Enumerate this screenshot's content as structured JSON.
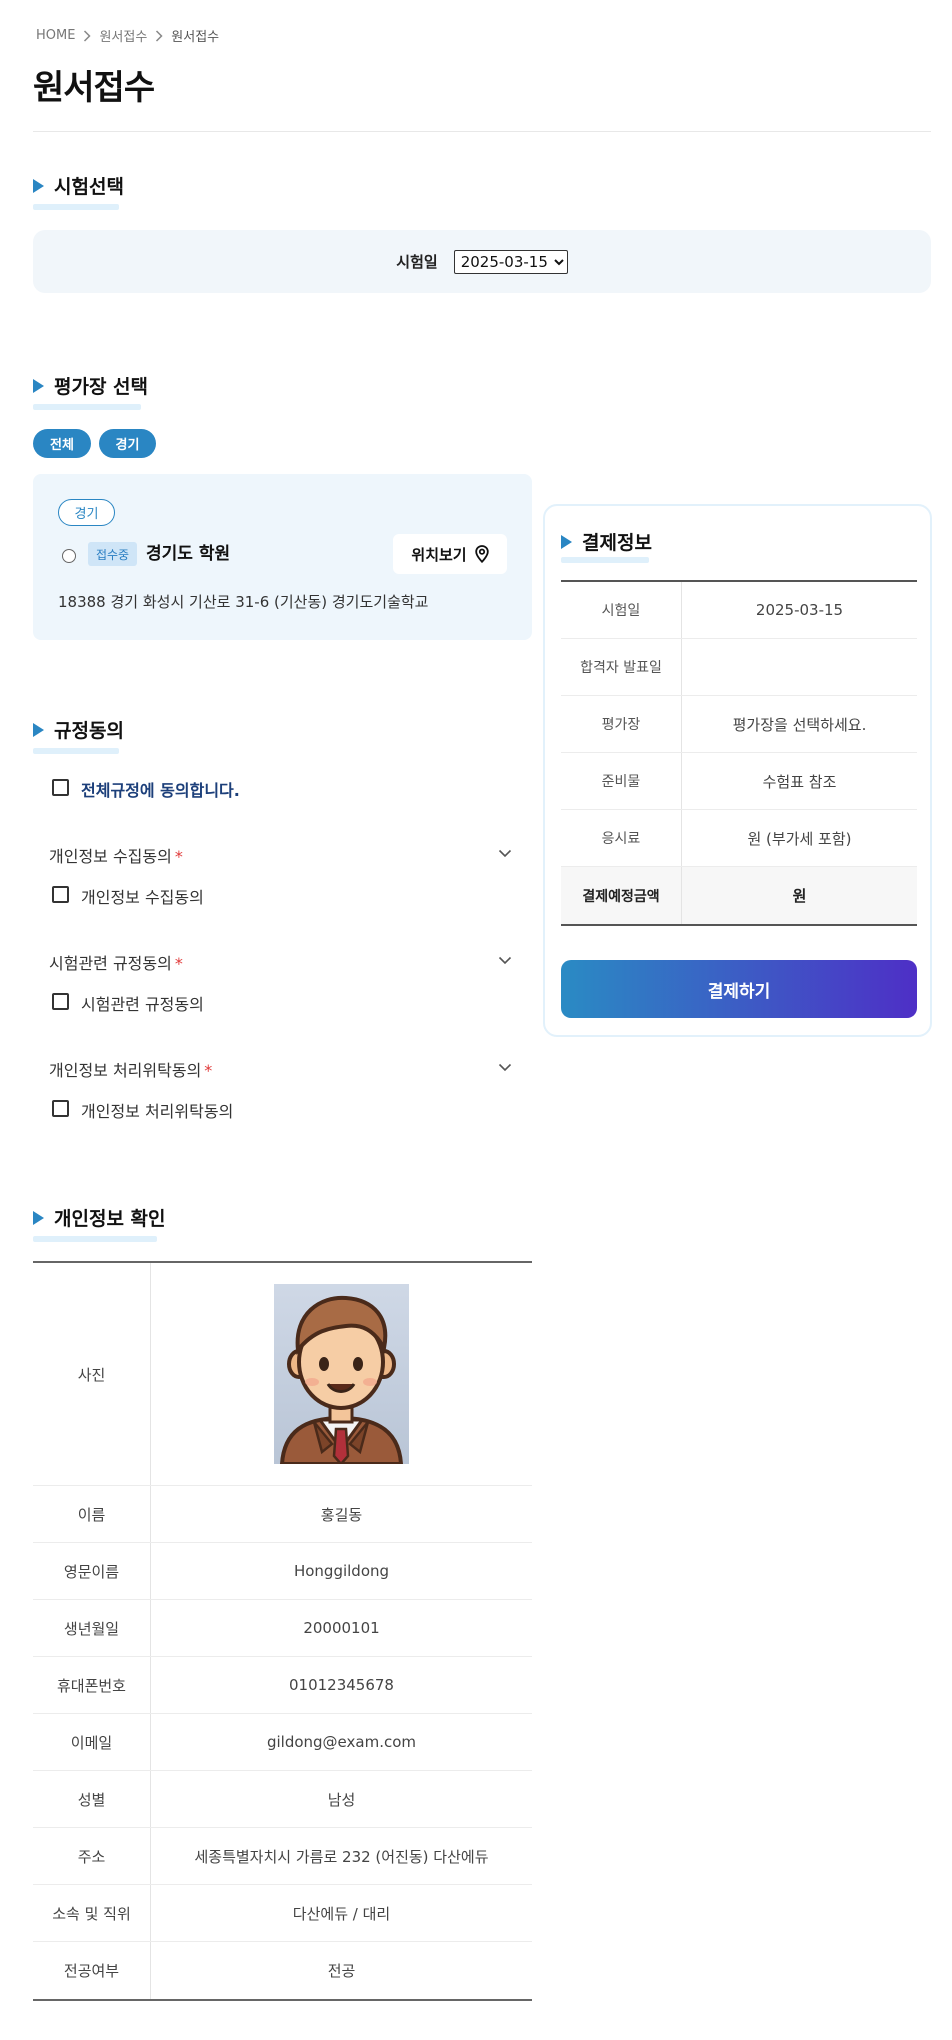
{
  "breadcrumb": {
    "home": "HOME",
    "level1": "원서접수",
    "level2": "원서접수"
  },
  "page_title": "원서접수",
  "exam_section": {
    "title": "시험선택",
    "date_label": "시험일",
    "date_value": "2025-03-15"
  },
  "venue_section": {
    "title": "평가장 선택",
    "filters": [
      "전체",
      "경기"
    ],
    "venue": {
      "region_tag": "경기",
      "status_badge": "접수중",
      "name": "경기도 학원",
      "location_button": "위치보기",
      "address": "18388 경기 화성시 기산로 31-6 (기산동) 경기도기술학교"
    }
  },
  "payment": {
    "title": "결제정보",
    "rows": [
      {
        "label": "시험일",
        "value": "2025-03-15"
      },
      {
        "label": "합격자 발표일",
        "value": ""
      },
      {
        "label": "평가장",
        "value": "평가장을 선택하세요."
      },
      {
        "label": "준비물",
        "value": "수험표 참조"
      },
      {
        "label": "응시료",
        "value": "원 (부가세 포함)"
      },
      {
        "label": "결제예정금액",
        "value": "원"
      }
    ],
    "button": "결제하기"
  },
  "agreement": {
    "title": "규정동의",
    "all_label": "전체규정에 동의합니다.",
    "items": [
      {
        "heading": "개인정보 수집동의",
        "required": "*",
        "checkbox_label": "개인정보 수집동의"
      },
      {
        "heading": "시험관련 규정동의",
        "required": "*",
        "checkbox_label": "시험관련 규정동의"
      },
      {
        "heading": "개인정보 처리위탁동의",
        "required": "*",
        "checkbox_label": "개인정보 처리위탁동의"
      }
    ]
  },
  "personal_info": {
    "title": "개인정보 확인",
    "photo_label": "사진",
    "rows": [
      {
        "label": "이름",
        "value": "홍길동"
      },
      {
        "label": "영문이름",
        "value": "Honggildong"
      },
      {
        "label": "생년월일",
        "value": "20000101"
      },
      {
        "label": "휴대폰번호",
        "value": "01012345678"
      },
      {
        "label": "이메일",
        "value": "gildong@exam.com"
      },
      {
        "label": "성별",
        "value": "남성"
      },
      {
        "label": "주소",
        "value": "세종특별자치시 가름로 232 (어진동) 다산에듀"
      },
      {
        "label": "소속 및 직위",
        "value": "다산에듀 / 대리"
      },
      {
        "label": "전공여부",
        "value": "전공"
      }
    ]
  },
  "colors": {
    "accent": "#2a86c3",
    "required": "#e03a3a",
    "button_gradient_start": "#2a8bc4",
    "button_gradient_end": "#4e2fc6"
  },
  "icons": {
    "breadcrumb_separator": "chevron-right-icon",
    "location": "map-pin-icon",
    "accordion": "chevron-down-icon",
    "section_marker": "triangle-icon"
  }
}
